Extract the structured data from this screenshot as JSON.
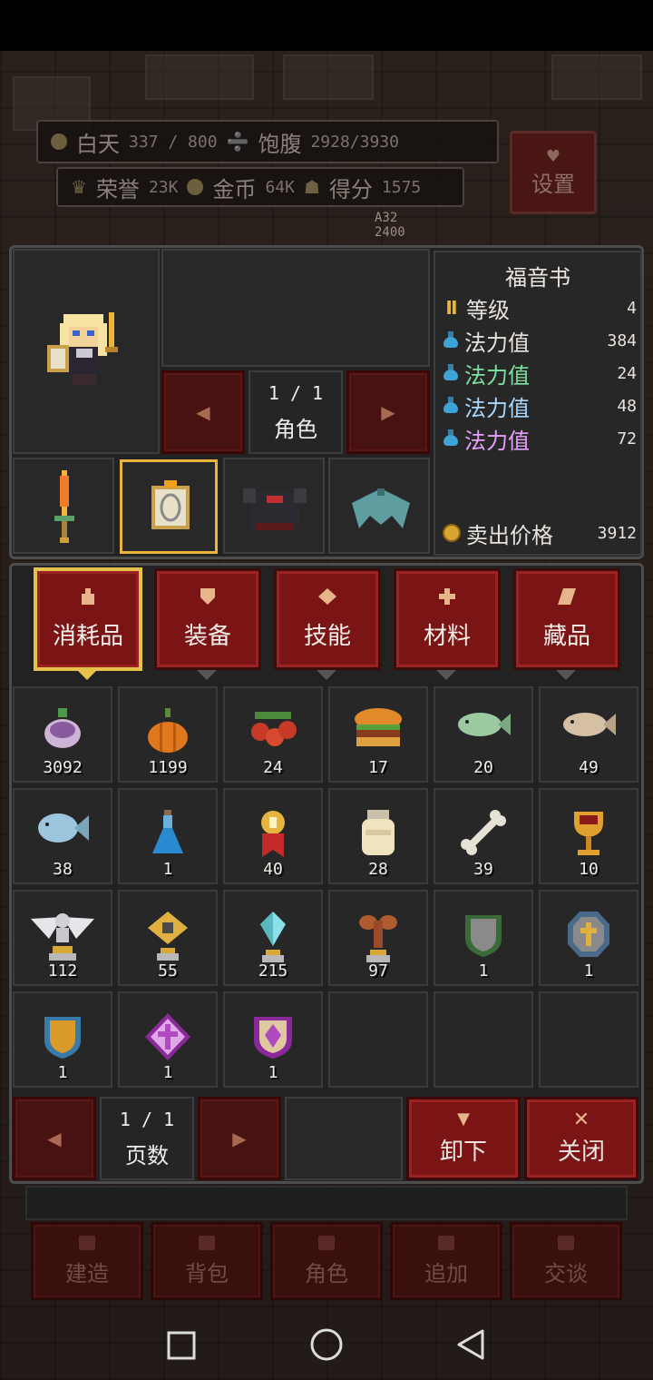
{
  "hud": {
    "day_label": "白天",
    "day_value": "337 / 800",
    "satiety_label": "饱腹",
    "satiety_value": "2928/3930",
    "honor_label": "荣誉",
    "honor_value": "23K",
    "gold_label": "金币",
    "gold_value": "64K",
    "score_label": "得分",
    "score_value": "1575",
    "settings_label": "设置",
    "mini_stat_top": "A32",
    "mini_stat_bottom": "2400"
  },
  "character": {
    "page": "1 / 1",
    "page_label": "角色"
  },
  "item_info": {
    "title": "福音书",
    "rows": [
      {
        "label": "等级",
        "value": "4",
        "color": "#efe9e2",
        "icon": "rank-icon"
      },
      {
        "label": "法力值",
        "value": "384",
        "color": "#efe9e2",
        "icon": "potion-icon"
      },
      {
        "label": "法力值",
        "value": "24",
        "color": "#7ee0a0",
        "icon": "potion-icon"
      },
      {
        "label": "法力值",
        "value": "48",
        "color": "#a8d8ff",
        "icon": "potion-icon"
      },
      {
        "label": "法力值",
        "value": "72",
        "color": "#e6a0ff",
        "icon": "potion-icon"
      }
    ],
    "sell_label": "卖出价格",
    "sell_value": "3912"
  },
  "tabs": [
    {
      "label": "消耗品",
      "icon": "flask-icon",
      "active": true
    },
    {
      "label": "装备",
      "icon": "shield-icon",
      "active": false
    },
    {
      "label": "技能",
      "icon": "diamond-icon",
      "active": false
    },
    {
      "label": "材料",
      "icon": "cross-icon",
      "active": false
    },
    {
      "label": "藏品",
      "icon": "scroll-icon",
      "active": false
    }
  ],
  "inventory": [
    {
      "name": "turnip",
      "qty": "3092"
    },
    {
      "name": "pumpkin",
      "qty": "1199"
    },
    {
      "name": "cherries",
      "qty": "24"
    },
    {
      "name": "burger",
      "qty": "17"
    },
    {
      "name": "green-fish",
      "qty": "20"
    },
    {
      "name": "tan-fish",
      "qty": "49"
    },
    {
      "name": "blue-fish",
      "qty": "38"
    },
    {
      "name": "blue-potion",
      "qty": "1"
    },
    {
      "name": "medal",
      "qty": "40"
    },
    {
      "name": "jar",
      "qty": "28"
    },
    {
      "name": "bone",
      "qty": "39"
    },
    {
      "name": "chalice",
      "qty": "10"
    },
    {
      "name": "angel-statue",
      "qty": "112"
    },
    {
      "name": "gold-gem-statue",
      "qty": "55"
    },
    {
      "name": "crystal-statue",
      "qty": "215"
    },
    {
      "name": "tree-statue",
      "qty": "97"
    },
    {
      "name": "iron-shield",
      "qty": "1"
    },
    {
      "name": "holy-shield",
      "qty": "1"
    },
    {
      "name": "gold-shield",
      "qty": "1"
    },
    {
      "name": "purple-cross-shield",
      "qty": "1"
    },
    {
      "name": "purple-gem-shield",
      "qty": "1"
    },
    {
      "name": "",
      "qty": ""
    },
    {
      "name": "",
      "qty": ""
    },
    {
      "name": "",
      "qty": ""
    }
  ],
  "footer": {
    "page": "1 / 1",
    "page_label": "页数",
    "unequip_label": "卸下",
    "close_label": "关闭"
  },
  "bottom_nav": [
    "建造",
    "背包",
    "角色",
    "追加",
    "交谈"
  ]
}
